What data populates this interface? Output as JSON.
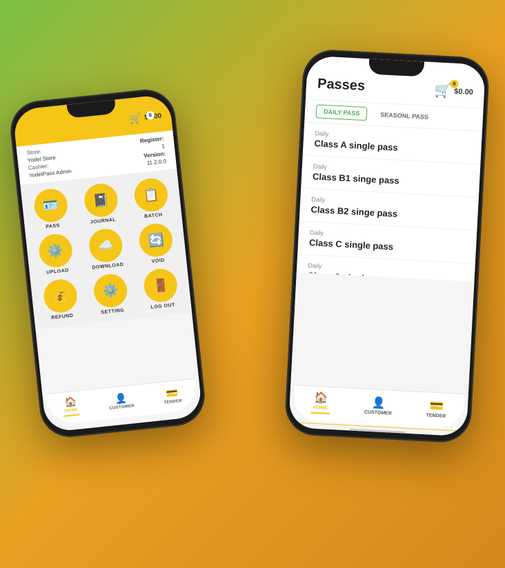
{
  "background": {
    "gradient_start": "#7bc142",
    "gradient_end": "#d4891a"
  },
  "phone_left": {
    "header": {
      "cart_amount": "$0.00",
      "cart_badge": "0"
    },
    "info": {
      "store_label": "Store:",
      "store_value": "Yodel Store",
      "register_label": "Register:",
      "register_value": "1",
      "cashier_label": "Cashier:",
      "cashier_value": "YodelPass Admin",
      "version_label": "Version:",
      "version_value": "11.2.0.0"
    },
    "grid_items": [
      {
        "label": "PASS",
        "icon": "🪪"
      },
      {
        "label": "JOURNAL",
        "icon": "📓"
      },
      {
        "label": "BATCH",
        "icon": "📋"
      },
      {
        "label": "UPLOAD",
        "icon": "⚙️"
      },
      {
        "label": "DOWNLOAD",
        "icon": "☁️"
      },
      {
        "label": "VOID",
        "icon": "🔄"
      },
      {
        "label": "REFUND",
        "icon": "💰"
      },
      {
        "label": "SETTING",
        "icon": "⚙️"
      },
      {
        "label": "LOG OUT",
        "icon": "🚪"
      }
    ],
    "bottom_nav": [
      {
        "label": "HOME",
        "icon": "🏠",
        "active": true
      },
      {
        "label": "CUSTOMER",
        "icon": "👤",
        "active": false
      },
      {
        "label": "TENDER",
        "icon": "💳",
        "active": false
      }
    ]
  },
  "phone_right": {
    "header": {
      "title": "Passes",
      "cart_amount": "$0.00",
      "cart_badge": "0"
    },
    "tabs": [
      {
        "label": "DAILY PASS",
        "active": true
      },
      {
        "label": "SEASONL PASS",
        "active": false
      }
    ],
    "pass_items": [
      {
        "category": "Daily",
        "name": "Class A single pass"
      },
      {
        "category": "Daily",
        "name": "Class B1 singe pass"
      },
      {
        "category": "Daily",
        "name": "Class B2 singe pass"
      },
      {
        "category": "Daily",
        "name": "Class C single pass"
      },
      {
        "category": "Daily",
        "name": "Class G single pass"
      }
    ],
    "bottom_nav": [
      {
        "label": "HOME",
        "icon": "🏠",
        "active": true
      },
      {
        "label": "CUSTOMER",
        "icon": "👤",
        "active": false
      },
      {
        "label": "TENDER",
        "icon": "💳",
        "active": false
      }
    ]
  }
}
